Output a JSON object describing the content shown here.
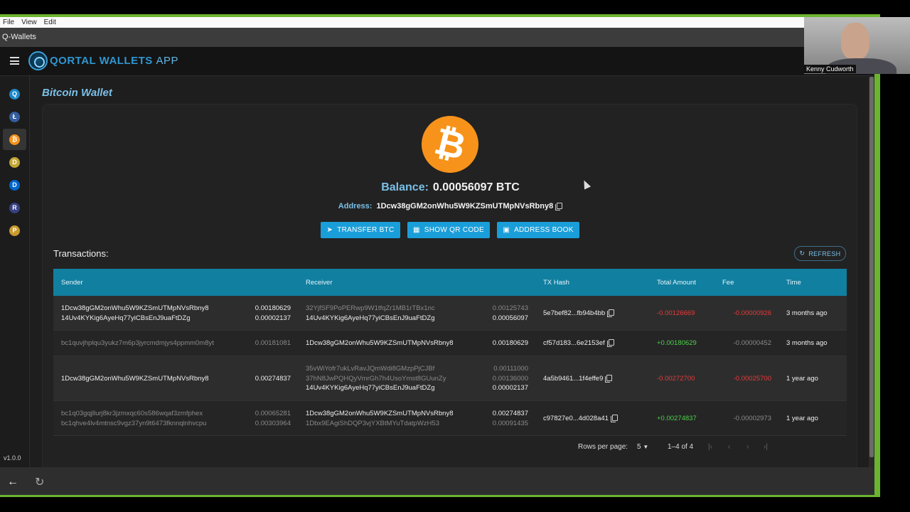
{
  "menubar": {
    "items": [
      "File",
      "View",
      "Edit"
    ]
  },
  "window": {
    "title": "Q-Wallets"
  },
  "app": {
    "name_main": "QORTAL WALLETS",
    "name_suffix": "APP",
    "version": "v1.0.0"
  },
  "sidebar": {
    "items": [
      {
        "name": "qortal",
        "glyph": "Q",
        "color": "#1e88c8",
        "active": false
      },
      {
        "name": "litecoin",
        "glyph": "Ł",
        "color": "#345d9d",
        "active": false
      },
      {
        "name": "bitcoin",
        "glyph": "₿",
        "color": "#f7931a",
        "active": true
      },
      {
        "name": "dogecoin",
        "glyph": "D",
        "color": "#c2a633",
        "active": false
      },
      {
        "name": "digibyte",
        "glyph": "D",
        "color": "#0066cc",
        "active": false
      },
      {
        "name": "ravencoin",
        "glyph": "R",
        "color": "#384182",
        "active": false
      },
      {
        "name": "pirate",
        "glyph": "P",
        "color": "#c99a2e",
        "active": false
      }
    ]
  },
  "wallet": {
    "title": "Bitcoin Wallet",
    "balance_label": "Balance:",
    "balance_value": "0.00056097 BTC",
    "address_label": "Address:",
    "address_value": "1Dcw38gGM2onWhu5W9KZSmUTMpNVsRbny8"
  },
  "buttons": {
    "transfer": "TRANSFER BTC",
    "qr": "SHOW QR CODE",
    "address_book": "ADDRESS BOOK",
    "refresh": "REFRESH"
  },
  "transactions": {
    "heading": "Transactions:",
    "columns": [
      "Sender",
      "Receiver",
      "TX Hash",
      "Total Amount",
      "Fee",
      "Time"
    ],
    "rows": [
      {
        "senders": [
          {
            "addr": "1Dcw38gGM2onWhu5W9KZSmUTMpNVsRbny8",
            "amt": "0.00180629",
            "dim": false
          },
          {
            "addr": "14Uv4KYKig6AyeHq77yiCBsEnJ9uaFtDZg",
            "amt": "0.00002137",
            "dim": false
          }
        ],
        "receivers": [
          {
            "addr": "32YjfSF9PoPERwp9W1tfqZr1MB1rTBx1nc",
            "amt": "0.00125743",
            "dim": true
          },
          {
            "addr": "14Uv4KYKig6AyeHq77yiCBsEnJ9uaFtDZg",
            "amt": "0.00056097",
            "dim": false
          }
        ],
        "hash": "5e7bef82...fb94b4bb",
        "total": "-0.00126669",
        "total_sign": "neg",
        "fee": "-0.00000926",
        "fee_sign": "neg",
        "time": "3 months ago"
      },
      {
        "senders": [
          {
            "addr": "bc1quvjhplqu3yukz7m6p3jyrcmdmjys4ppmm0m8yt",
            "amt": "0.00181081",
            "dim": true
          }
        ],
        "receivers": [
          {
            "addr": "1Dcw38gGM2onWhu5W9KZSmUTMpNVsRbny8",
            "amt": "0.00180629",
            "dim": false
          }
        ],
        "hash": "cf57d183...6e2153ef",
        "total": "+0.00180629",
        "total_sign": "pos",
        "fee": "-0.00000452",
        "fee_sign": "dim",
        "time": "3 months ago"
      },
      {
        "senders": [
          {
            "addr": "1Dcw38gGM2onWhu5W9KZSmUTMpNVsRbny8",
            "amt": "0.00274837",
            "dim": false
          }
        ],
        "receivers": [
          {
            "addr": "35vWiYofr7ukLvRavJQmWdi8GMzpPjCJBf",
            "amt": "0.00111000",
            "dim": true
          },
          {
            "addr": "37hN8JwPQHQyVmrGh7h4UsoYmst8GUunZy",
            "amt": "0.00136000",
            "dim": true
          },
          {
            "addr": "14Uv4KYKig6AyeHq77yiCBsEnJ9uaFtDZg",
            "amt": "0.00002137",
            "dim": false
          }
        ],
        "hash": "4a5b9461...1f4effe9",
        "total": "-0.00272700",
        "total_sign": "neg",
        "fee": "-0.00025700",
        "fee_sign": "neg",
        "time": "1 year ago"
      },
      {
        "senders": [
          {
            "addr": "bc1q03gqjllurj8kr3jzmxqc60s586wqaf3zmfphex",
            "amt": "0.00065281",
            "dim": true
          },
          {
            "addr": "bc1qhve4lv4mtnsc9vgz37yn9t6473fknnqlnhvcpu",
            "amt": "0.00303964",
            "dim": true
          }
        ],
        "receivers": [
          {
            "addr": "1Dcw38gGM2onWhu5W9KZSmUTMpNVsRbny8",
            "amt": "0.00274837",
            "dim": false
          },
          {
            "addr": "1Dbx9EAgiShDQP3vjYXBtMYuTdatpWzH53",
            "amt": "0.00091435",
            "dim": true
          }
        ],
        "hash": "c97827e0...4d028a41",
        "total": "+0.00274837",
        "total_sign": "pos",
        "fee": "-0.00002973",
        "fee_sign": "dim",
        "time": "1 year ago"
      }
    ]
  },
  "pagination": {
    "rows_label": "Rows per page:",
    "rows_value": "5",
    "range": "1–4 of 4"
  },
  "webcam": {
    "name": "Kenny Cudworth"
  },
  "colors": {
    "accent": "#1a9ed9",
    "header": "#117fa0",
    "negative": "#e83a3a",
    "positive": "#4cd24c",
    "bitcoin": "#f7931a"
  }
}
